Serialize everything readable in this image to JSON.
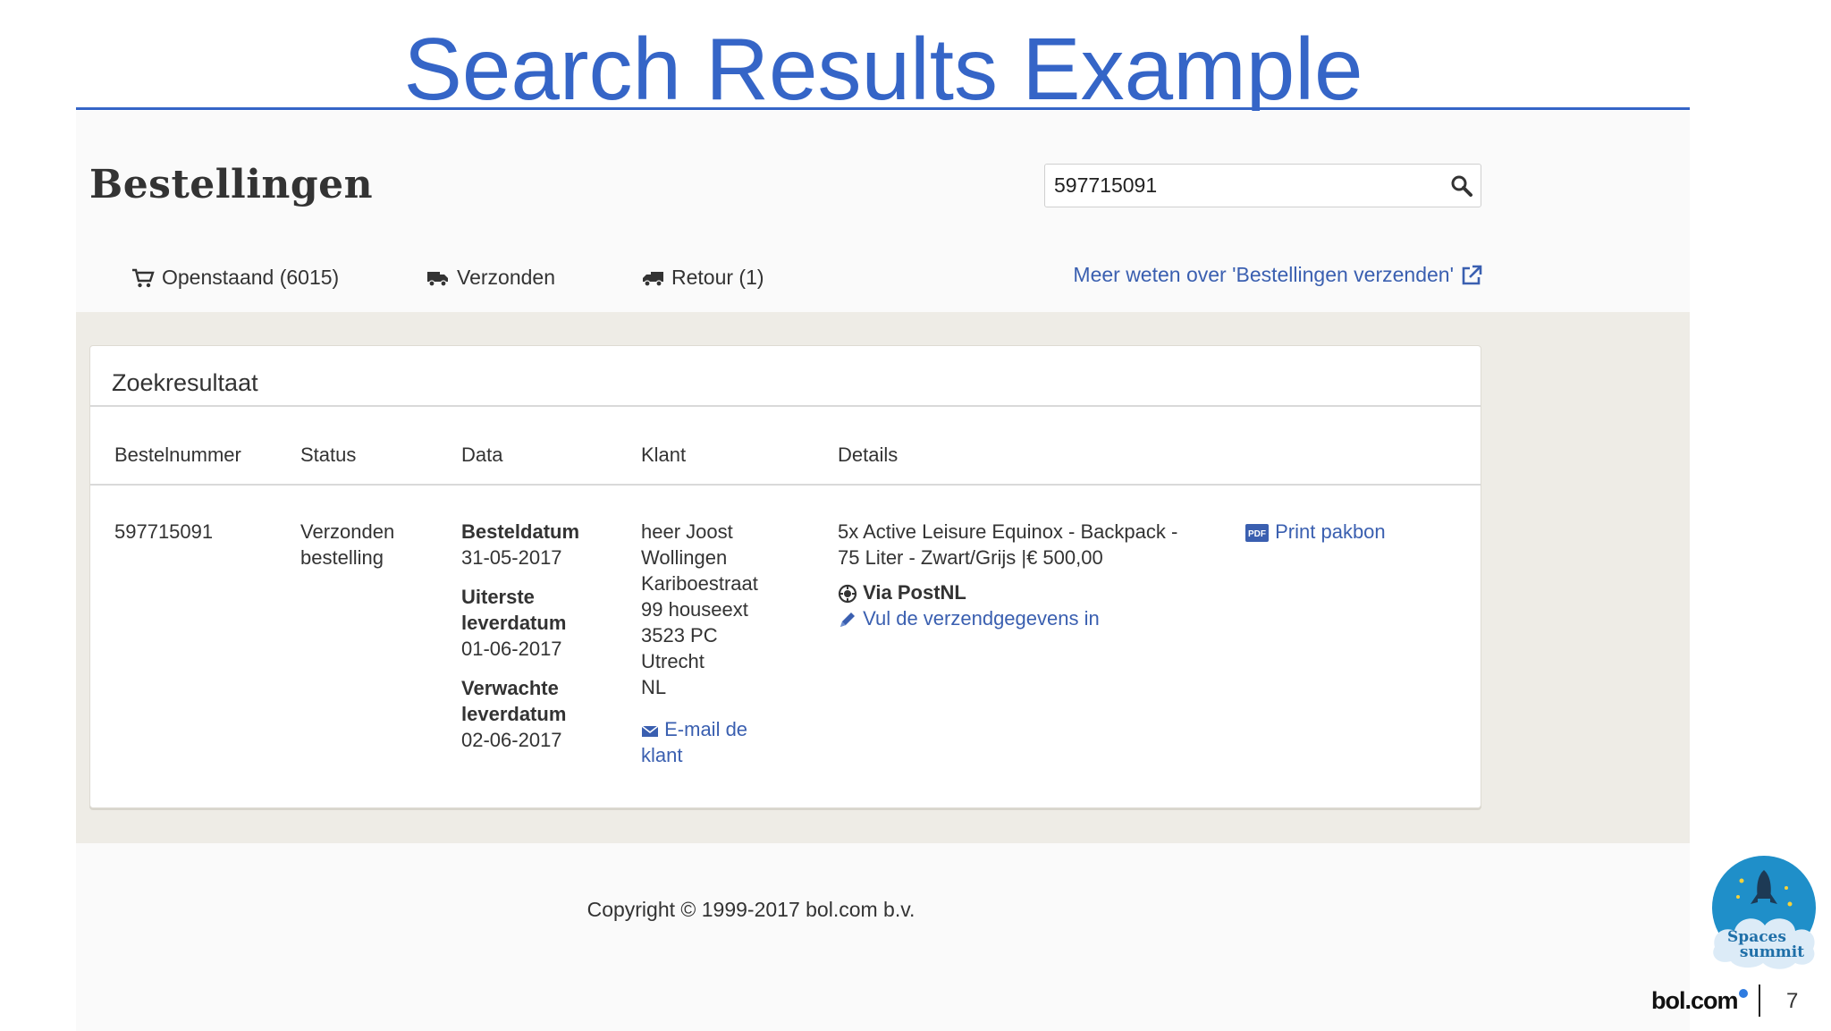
{
  "slide": {
    "title": "Search Results Example",
    "page_number": "7",
    "accent_color": "#3565c7"
  },
  "app": {
    "page_heading": "Bestellingen",
    "search": {
      "value": "597715091"
    },
    "tabs": [
      {
        "label": "Openstaand (6015)",
        "icon": "cart-icon"
      },
      {
        "label": "Verzonden",
        "icon": "truck-icon"
      },
      {
        "label": "Retour (1)",
        "icon": "return-truck-icon"
      }
    ],
    "info_link": {
      "label": "Meer weten over 'Bestellingen verzenden'",
      "icon": "external-link-icon"
    },
    "results": {
      "title": "Zoekresultaat",
      "columns": [
        "Bestelnummer",
        "Status",
        "Data",
        "Klant",
        "Details"
      ],
      "row": {
        "order_number": "597715091",
        "status": [
          "Verzonden",
          "bestelling"
        ],
        "dates": {
          "order_date_label": "Besteldatum",
          "order_date": "31-05-2017",
          "latest_delivery_label": [
            "Uiterste",
            "leverdatum"
          ],
          "latest_delivery": "01-06-2017",
          "expected_delivery_label": [
            "Verwachte",
            "leverdatum"
          ],
          "expected_delivery": "02-06-2017"
        },
        "customer": {
          "lines": [
            "heer Joost",
            "Wollingen",
            "Kariboestraat",
            "99 houseext",
            "3523 PC",
            "Utrecht",
            "NL"
          ],
          "email_link": [
            "E-mail de",
            "klant"
          ]
        },
        "details": {
          "product_lines": [
            "5x Active Leisure Equinox - Backpack -",
            "75 Liter - Zwart/Grijs |€ 500,00"
          ],
          "shipping_method": "Via PostNL",
          "fill_shipping_link": "Vul de verzendgegevens in"
        },
        "print_link": "Print pakbon"
      }
    },
    "copyright": "Copyright © 1999-2017 bol.com b.v.",
    "link_color": "#3a5fb0",
    "band_color": "#eeece6"
  },
  "branding": {
    "spaces_logo_text": [
      "Spaces",
      "summit"
    ],
    "bol_logo_text": "bol.com"
  }
}
